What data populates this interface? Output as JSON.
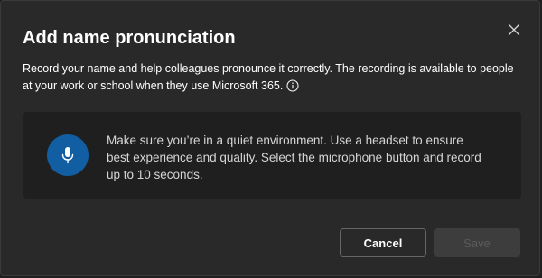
{
  "dialog": {
    "title": "Add name pronunciation",
    "description": "Record your name and help colleagues pronounce it correctly. The recording is available to people at your work or school when they use Microsoft 365.",
    "info_icon": "info-icon",
    "close_icon": "close-icon"
  },
  "recorder": {
    "mic_icon": "microphone-icon",
    "instructions": "Make sure you’re in a quiet environment. Use a headset to ensure best experience and quality. Select the microphone button and record up to 10 seconds."
  },
  "actions": {
    "cancel_label": "Cancel",
    "save_label": "Save",
    "save_disabled": true
  },
  "colors": {
    "dialog_bg": "#292929",
    "panel_bg": "#1f1f1f",
    "mic_button_bg": "#115ea3",
    "text_primary": "#ffffff"
  }
}
